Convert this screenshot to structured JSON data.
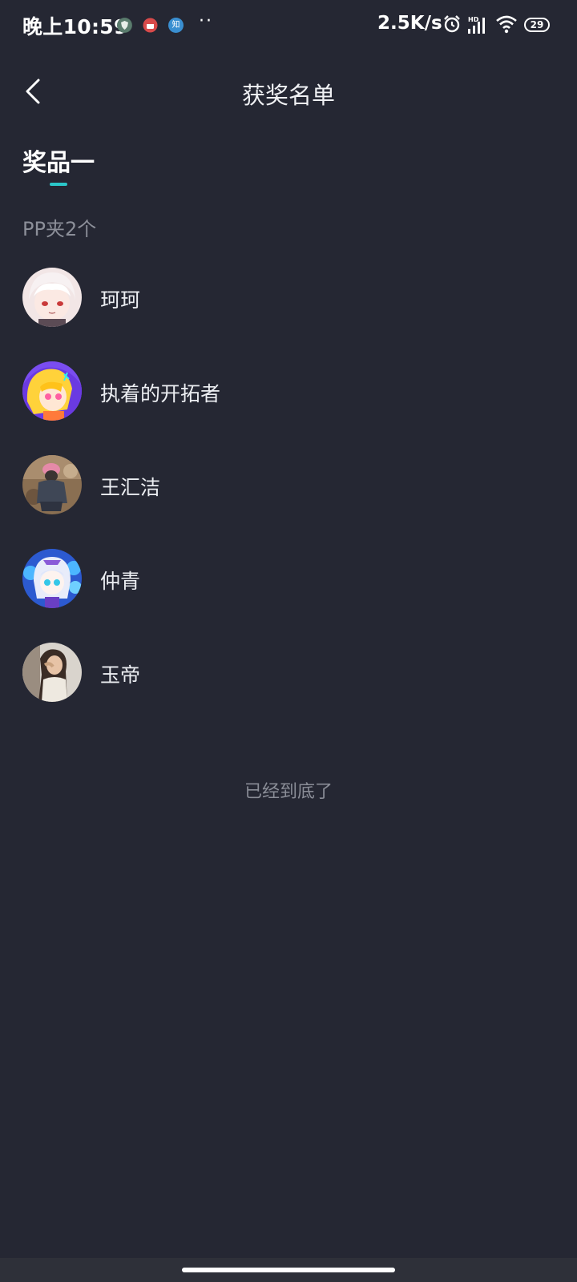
{
  "status_bar": {
    "time": "晚上10:59",
    "notif_icon_zhi": "知",
    "dots": "··",
    "net_speed": "2.5K/s",
    "battery": "29"
  },
  "header": {
    "title": "获奖名单"
  },
  "tab": {
    "label": "奖品一",
    "accent_color": "#2bc6c9"
  },
  "prize": {
    "description": "PP夹2个"
  },
  "winners": [
    {
      "name": "珂珂",
      "avatar": "anime-white-hair-avatar"
    },
    {
      "name": "执着的开拓者",
      "avatar": "cartoon-yellow-hair-avatar"
    },
    {
      "name": "王汇洁",
      "avatar": "photo-person-crouching-avatar"
    },
    {
      "name": "仲青",
      "avatar": "anime-blue-avatar"
    },
    {
      "name": "玉帝",
      "avatar": "photo-woman-avatar"
    }
  ],
  "footer": {
    "end_text": "已经到底了"
  },
  "colors": {
    "background": "#252733",
    "accent": "#2bc6c9"
  }
}
